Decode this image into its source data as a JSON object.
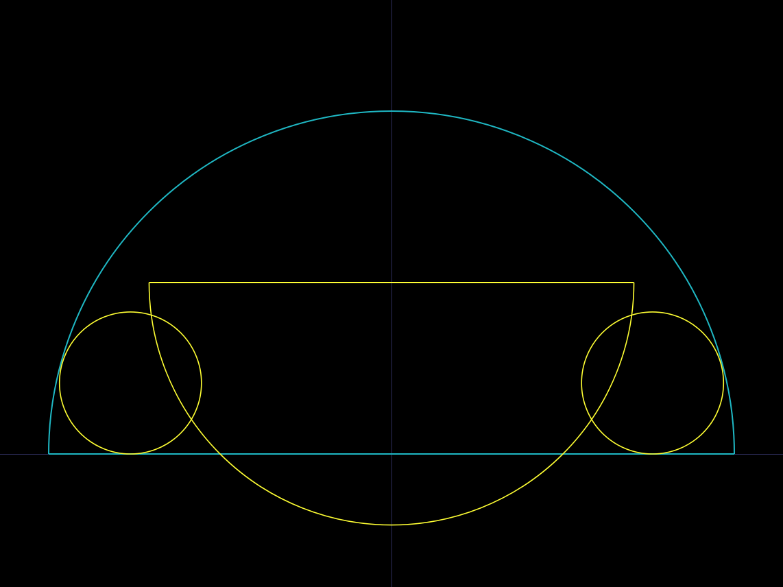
{
  "colors": {
    "background": "#000000",
    "axes": "#2e2e5c",
    "outer_semicircle": "#1fb8c4",
    "inscribed_shapes": "#ffff33"
  },
  "figure": {
    "outer_semicircle": {
      "center": [
        0,
        0
      ],
      "radius": 1.0
    },
    "inner_semicircle": {
      "center": [
        0,
        0.5
      ],
      "radius": 0.70710678,
      "chord_y": 0.5
    },
    "small_circles": [
      {
        "name": "left",
        "center": [
          -0.76146428,
          0.20710678
        ],
        "radius": 0.20710678
      },
      {
        "name": "right",
        "center": [
          0.76146428,
          0.20710678
        ],
        "radius": 0.20710678
      }
    ]
  }
}
